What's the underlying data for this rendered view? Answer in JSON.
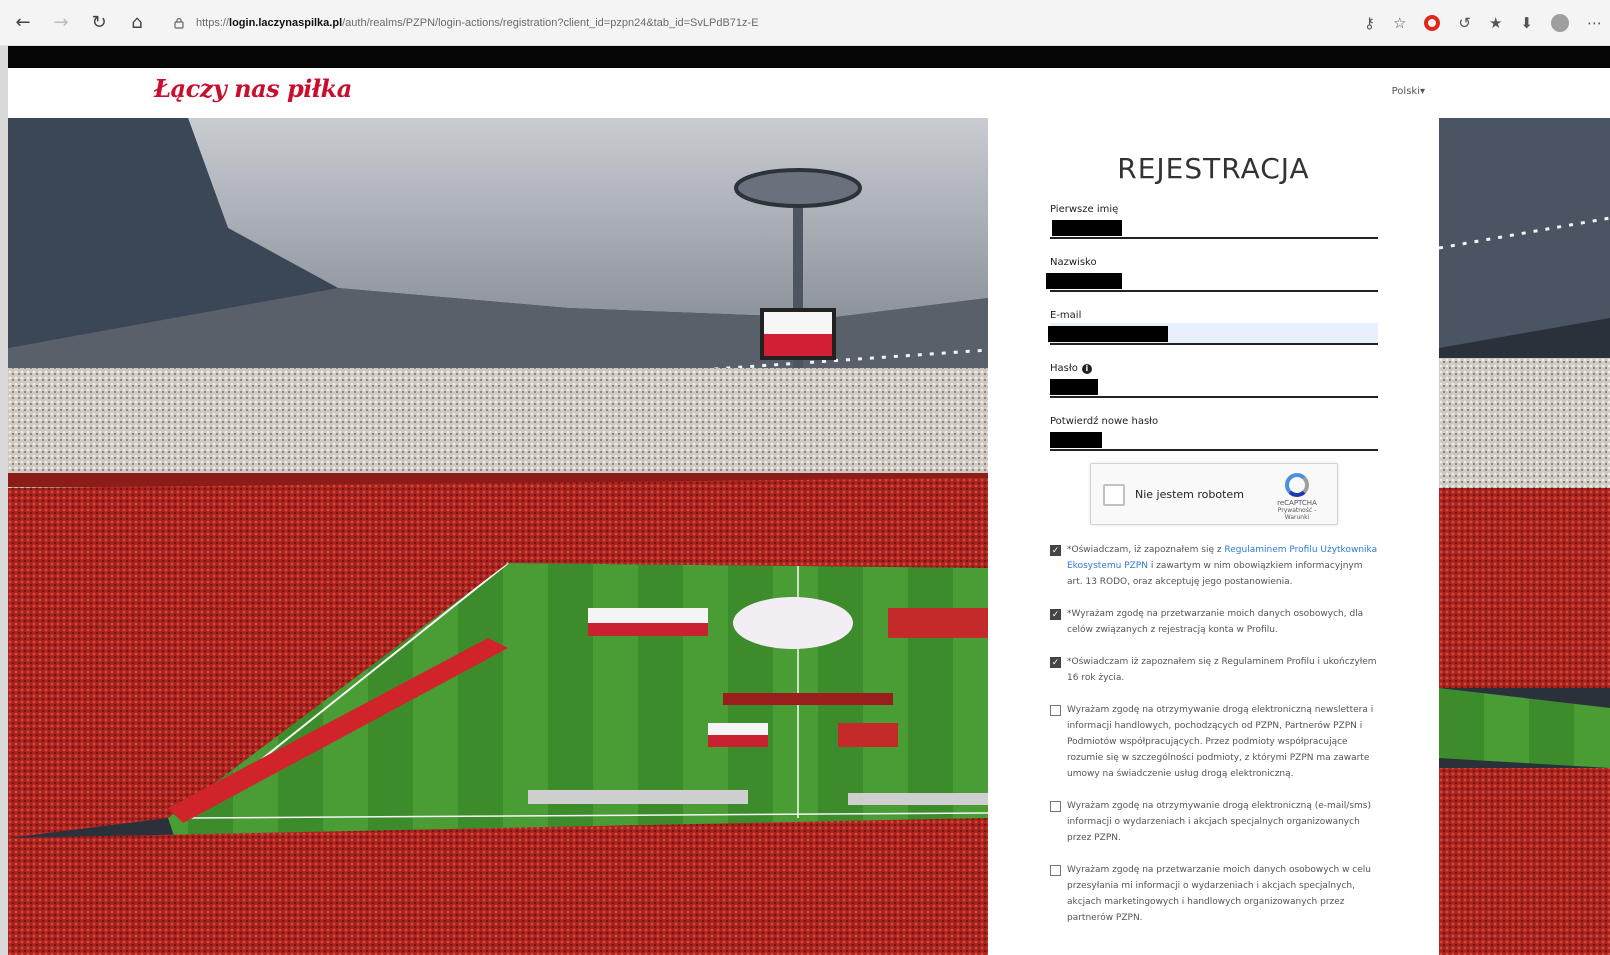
{
  "browser": {
    "url_prefix": "https://",
    "url_host": "login.laczynaspilka.pl",
    "url_path": "/auth/realms/PZPN/login-actions/registration?client_id=pzpn24&tab_id=SvLPdB71z-E",
    "icons": [
      "back-icon",
      "forward-icon",
      "reload-icon",
      "home-icon",
      "lock-icon",
      "key-icon",
      "favorite-add-icon",
      "opera-icon",
      "extension-icon",
      "favorites-icon",
      "downloads-icon",
      "profile-icon",
      "more-icon"
    ]
  },
  "site": {
    "logo": "Łączy nas piłka",
    "language": "Polski▾"
  },
  "form": {
    "title": "REJESTRACJA",
    "first_name_label": "Pierwsze imię",
    "last_name_label": "Nazwisko",
    "email_label": "E-mail",
    "password_label": "Hasło",
    "password_info": "i",
    "confirm_label": "Potwierdź nowe hasło",
    "captcha_label": "Nie jestem robotem",
    "captcha_brand": "reCAPTCHA",
    "captcha_links": "Prywatność - Warunki"
  },
  "consents": [
    {
      "checked": true,
      "prefix": "*Oświadczam, iż zapoznałem się z ",
      "link": "Regulaminem Profilu Użytkownika Ekosystemu PZPN",
      "suffix": " i zawartym w nim obowiązkiem informacyjnym art. 13 RODO, oraz akceptuję jego postanowienia."
    },
    {
      "checked": true,
      "text": "*Wyrażam zgodę na przetwarzanie moich danych osobowych, dla celów związanych z rejestracją konta w Profilu."
    },
    {
      "checked": true,
      "text": "*Oświadczam iż zapoznałem się z Regulaminem Profilu i ukończyłem 16 rok życia."
    },
    {
      "checked": false,
      "text": "Wyrażam zgodę na otrzymywanie drogą elektroniczną newslettera i informacji handlowych, pochodzących od PZPN, Partnerów PZPN i Podmiotów współpracujących. Przez podmioty współpracujące rozumie się w szczególności podmioty, z którymi PZPN ma zawarte umowy na świadczenie usług drogą elektroniczną."
    },
    {
      "checked": false,
      "text": "Wyrażam zgodę na otrzymywanie drogą elektroniczną (e-mail/sms) informacji o wydarzeniach i akcjach specjalnych organizowanych przez PZPN."
    },
    {
      "checked": false,
      "text": "Wyrażam zgodę na przetwarzanie moich danych osobowych w celu przesyłania mi informacji o wydarzeniach i akcjach specjalnych, akcjach marketingowych i handlowych organizowanych przez partnerów PZPN."
    }
  ],
  "colors": {
    "brand": "#c8102e",
    "link": "#2e7bd6",
    "pitch": "#3f8f2f"
  }
}
